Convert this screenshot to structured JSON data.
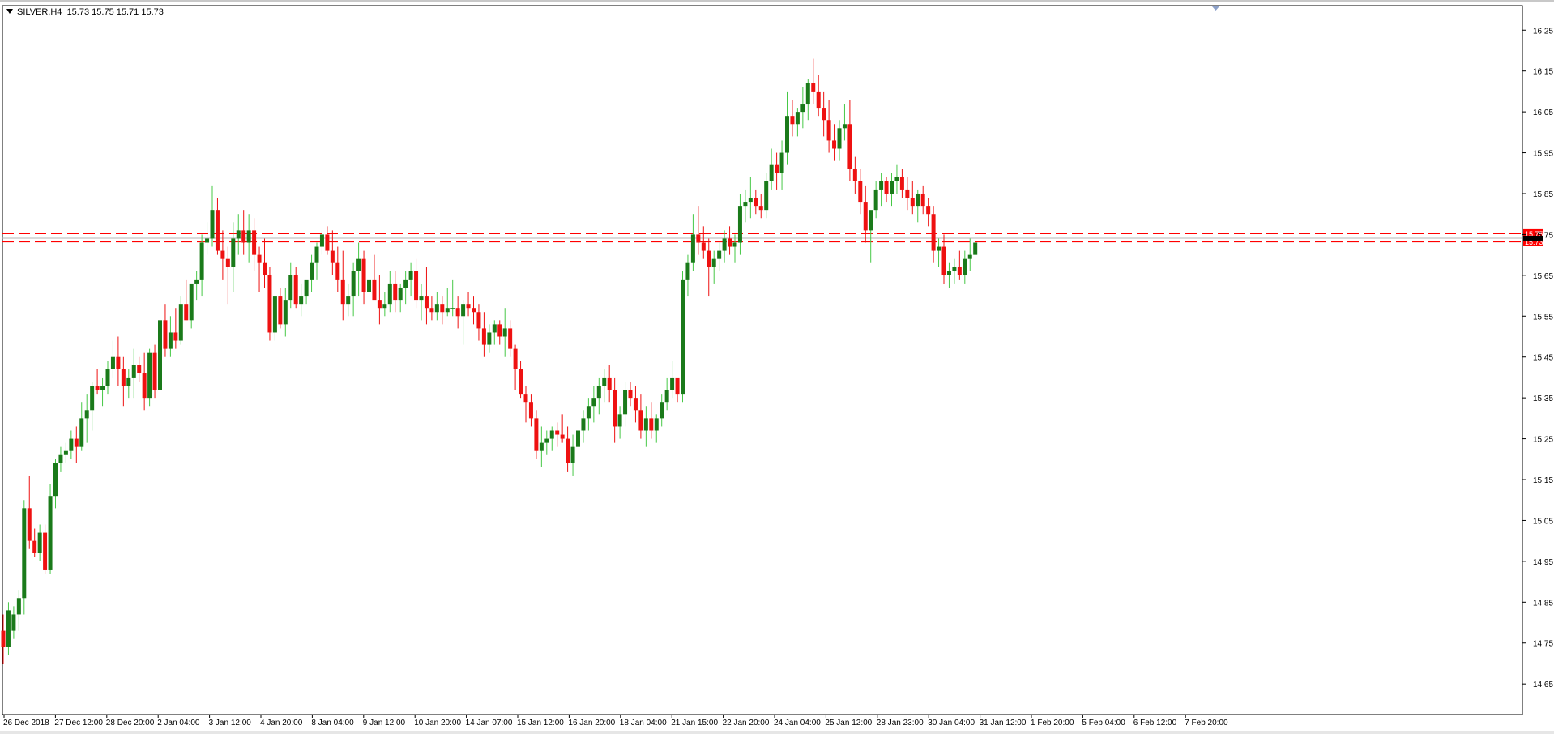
{
  "symbol": {
    "name": "SILVER,H4",
    "open": "15.73",
    "high": "15.75",
    "low": "15.71",
    "close": "15.73"
  },
  "chart_data": {
    "type": "candlestick",
    "ylim": [
      14.575,
      16.31
    ],
    "y_ticks": [
      "16.25",
      "16.15",
      "16.05",
      "15.95",
      "15.85",
      "15.75",
      "15.65",
      "15.55",
      "15.45",
      "15.35",
      "15.25",
      "15.15",
      "15.05",
      "14.95",
      "14.85",
      "14.75",
      "14.65"
    ],
    "x_ticks": [
      "26 Dec 2018",
      "27 Dec 12:00",
      "28 Dec 20:00",
      "2 Jan 04:00",
      "3 Jan 12:00",
      "4 Jan 20:00",
      "8 Jan 04:00",
      "9 Jan 12:00",
      "10 Jan 20:00",
      "14 Jan 07:00",
      "15 Jan 12:00",
      "16 Jan 20:00",
      "18 Jan 04:00",
      "21 Jan 15:00",
      "22 Jan 20:00",
      "24 Jan 04:00",
      "25 Jan 12:00",
      "28 Jan 23:00",
      "30 Jan 04:00",
      "31 Jan 12:00",
      "1 Feb 20:00",
      "5 Feb 04:00",
      "6 Feb 12:00",
      "7 Feb 20:00"
    ],
    "price_lines": [
      {
        "label": "15.75",
        "value": 15.752,
        "color": "#ff0000"
      },
      {
        "label": "15.73",
        "value": 15.732,
        "color": "#ff0000"
      }
    ],
    "current_price_line": 15.741,
    "candles": [
      [
        14.78,
        14.82,
        14.7,
        14.74
      ],
      [
        14.74,
        14.85,
        14.72,
        14.83
      ],
      [
        14.78,
        14.84,
        14.76,
        14.82
      ],
      [
        14.82,
        14.88,
        14.78,
        14.86
      ],
      [
        14.86,
        15.1,
        14.82,
        15.08
      ],
      [
        15.08,
        15.16,
        14.98,
        15.0
      ],
      [
        15.0,
        15.03,
        14.96,
        14.97
      ],
      [
        14.97,
        15.04,
        14.95,
        15.02
      ],
      [
        15.02,
        15.04,
        14.92,
        14.93
      ],
      [
        14.93,
        15.14,
        14.92,
        15.11
      ],
      [
        15.11,
        15.2,
        15.08,
        15.19
      ],
      [
        15.19,
        15.23,
        15.17,
        15.21
      ],
      [
        15.21,
        15.24,
        15.19,
        15.22
      ],
      [
        15.22,
        15.27,
        15.2,
        15.25
      ],
      [
        15.25,
        15.28,
        15.19,
        15.23
      ],
      [
        15.23,
        15.34,
        15.22,
        15.3
      ],
      [
        15.3,
        15.36,
        15.24,
        15.32
      ],
      [
        15.32,
        15.39,
        15.27,
        15.38
      ],
      [
        15.38,
        15.42,
        15.36,
        15.37
      ],
      [
        15.37,
        15.4,
        15.33,
        15.38
      ],
      [
        15.38,
        15.44,
        15.36,
        15.42
      ],
      [
        15.42,
        15.49,
        15.4,
        15.45
      ],
      [
        15.45,
        15.5,
        15.38,
        15.42
      ],
      [
        15.42,
        15.45,
        15.33,
        15.38
      ],
      [
        15.38,
        15.42,
        15.35,
        15.4
      ],
      [
        15.4,
        15.47,
        15.35,
        15.43
      ],
      [
        15.43,
        15.45,
        15.39,
        15.41
      ],
      [
        15.41,
        15.46,
        15.32,
        15.35
      ],
      [
        15.35,
        15.47,
        15.33,
        15.46
      ],
      [
        15.46,
        15.48,
        15.35,
        15.37
      ],
      [
        15.37,
        15.56,
        15.36,
        15.54
      ],
      [
        15.54,
        15.58,
        15.45,
        15.47
      ],
      [
        15.47,
        15.55,
        15.45,
        15.51
      ],
      [
        15.51,
        15.57,
        15.47,
        15.49
      ],
      [
        15.49,
        15.6,
        15.48,
        15.58
      ],
      [
        15.58,
        15.64,
        15.54,
        15.54
      ],
      [
        15.54,
        15.61,
        15.52,
        15.63
      ],
      [
        15.63,
        15.66,
        15.59,
        15.64
      ],
      [
        15.64,
        15.75,
        15.6,
        15.73
      ],
      [
        15.73,
        15.78,
        15.7,
        15.74
      ],
      [
        15.74,
        15.87,
        15.72,
        15.81
      ],
      [
        15.81,
        15.84,
        15.7,
        15.71
      ],
      [
        15.71,
        15.76,
        15.64,
        15.69
      ],
      [
        15.69,
        15.72,
        15.58,
        15.67
      ],
      [
        15.67,
        15.78,
        15.61,
        15.74
      ],
      [
        15.74,
        15.8,
        15.7,
        15.76
      ],
      [
        15.76,
        15.81,
        15.7,
        15.73
      ],
      [
        15.73,
        15.8,
        15.68,
        15.76
      ],
      [
        15.76,
        15.79,
        15.66,
        15.7
      ],
      [
        15.7,
        15.72,
        15.61,
        15.68
      ],
      [
        15.68,
        15.74,
        15.62,
        15.65
      ],
      [
        15.65,
        15.67,
        15.49,
        15.51
      ],
      [
        15.51,
        15.58,
        15.49,
        15.6
      ],
      [
        15.6,
        15.62,
        15.52,
        15.53
      ],
      [
        15.53,
        15.62,
        15.5,
        15.59
      ],
      [
        15.59,
        15.68,
        15.57,
        15.65
      ],
      [
        15.65,
        15.67,
        15.57,
        15.58
      ],
      [
        15.58,
        15.63,
        15.55,
        15.6
      ],
      [
        15.6,
        15.62,
        15.58,
        15.64
      ],
      [
        15.64,
        15.7,
        15.61,
        15.68
      ],
      [
        15.68,
        15.73,
        15.64,
        15.72
      ],
      [
        15.72,
        15.76,
        15.7,
        15.75
      ],
      [
        15.75,
        15.77,
        15.7,
        15.71
      ],
      [
        15.71,
        15.76,
        15.65,
        15.68
      ],
      [
        15.68,
        15.72,
        15.61,
        15.64
      ],
      [
        15.64,
        15.71,
        15.54,
        15.58
      ],
      [
        15.58,
        15.63,
        15.55,
        15.6
      ],
      [
        15.6,
        15.68,
        15.55,
        15.66
      ],
      [
        15.66,
        15.73,
        15.6,
        15.69
      ],
      [
        15.69,
        15.71,
        15.58,
        15.61
      ],
      [
        15.61,
        15.67,
        15.55,
        15.64
      ],
      [
        15.64,
        15.7,
        15.6,
        15.59
      ],
      [
        15.59,
        15.65,
        15.53,
        15.57
      ],
      [
        15.57,
        15.61,
        15.55,
        15.58
      ],
      [
        15.58,
        15.66,
        15.56,
        15.63
      ],
      [
        15.63,
        15.66,
        15.56,
        15.59
      ],
      [
        15.59,
        15.63,
        15.56,
        15.62
      ],
      [
        15.62,
        15.66,
        15.58,
        15.64
      ],
      [
        15.64,
        15.68,
        15.6,
        15.66
      ],
      [
        15.66,
        15.69,
        15.57,
        15.59
      ],
      [
        15.59,
        15.63,
        15.54,
        15.6
      ],
      [
        15.6,
        15.67,
        15.53,
        15.57
      ],
      [
        15.57,
        15.6,
        15.54,
        15.56
      ],
      [
        15.56,
        15.61,
        15.54,
        15.58
      ],
      [
        15.58,
        15.6,
        15.53,
        15.56
      ],
      [
        15.56,
        15.62,
        15.55,
        15.57
      ],
      [
        15.57,
        15.64,
        15.55,
        15.57
      ],
      [
        15.57,
        15.6,
        15.52,
        15.55
      ],
      [
        15.55,
        15.59,
        15.48,
        15.58
      ],
      [
        15.58,
        15.61,
        15.55,
        15.57
      ],
      [
        15.57,
        15.6,
        15.53,
        15.56
      ],
      [
        15.56,
        15.58,
        15.49,
        15.52
      ],
      [
        15.52,
        15.56,
        15.45,
        15.48
      ],
      [
        15.48,
        15.53,
        15.46,
        15.51
      ],
      [
        15.51,
        15.54,
        15.48,
        15.53
      ],
      [
        15.53,
        15.54,
        15.48,
        15.5
      ],
      [
        15.5,
        15.57,
        15.45,
        15.52
      ],
      [
        15.52,
        15.54,
        15.45,
        15.47
      ],
      [
        15.47,
        15.48,
        15.37,
        15.42
      ],
      [
        15.42,
        15.44,
        15.35,
        15.36
      ],
      [
        15.36,
        15.38,
        15.29,
        15.34
      ],
      [
        15.34,
        15.36,
        15.28,
        15.3
      ],
      [
        15.3,
        15.32,
        15.2,
        15.22
      ],
      [
        15.22,
        15.28,
        15.18,
        15.24
      ],
      [
        15.24,
        15.27,
        15.21,
        15.25
      ],
      [
        15.25,
        15.28,
        15.22,
        15.27
      ],
      [
        15.27,
        15.29,
        15.23,
        15.26
      ],
      [
        15.26,
        15.31,
        15.24,
        15.25
      ],
      [
        15.25,
        15.28,
        15.17,
        15.19
      ],
      [
        15.19,
        15.26,
        15.16,
        15.23
      ],
      [
        15.23,
        15.28,
        15.2,
        15.27
      ],
      [
        15.27,
        15.32,
        15.24,
        15.3
      ],
      [
        15.3,
        15.35,
        15.27,
        15.33
      ],
      [
        15.33,
        15.38,
        15.29,
        15.35
      ],
      [
        15.35,
        15.4,
        15.31,
        15.38
      ],
      [
        15.38,
        15.42,
        15.34,
        15.4
      ],
      [
        15.4,
        15.43,
        15.34,
        15.37
      ],
      [
        15.37,
        15.4,
        15.24,
        15.28
      ],
      [
        15.28,
        15.33,
        15.25,
        15.31
      ],
      [
        15.31,
        15.39,
        15.28,
        15.37
      ],
      [
        15.37,
        15.39,
        15.33,
        15.35
      ],
      [
        15.35,
        15.38,
        15.29,
        15.32
      ],
      [
        15.32,
        15.36,
        15.25,
        15.27
      ],
      [
        15.27,
        15.33,
        15.23,
        15.3
      ],
      [
        15.3,
        15.34,
        15.25,
        15.27
      ],
      [
        15.27,
        15.31,
        15.24,
        15.3
      ],
      [
        15.3,
        15.36,
        15.28,
        15.34
      ],
      [
        15.34,
        15.4,
        15.32,
        15.37
      ],
      [
        15.37,
        15.44,
        15.35,
        15.4
      ],
      [
        15.4,
        15.39,
        15.34,
        15.36
      ],
      [
        15.36,
        15.66,
        15.34,
        15.64
      ],
      [
        15.64,
        15.7,
        15.6,
        15.68
      ],
      [
        15.68,
        15.8,
        15.66,
        15.75
      ],
      [
        15.75,
        15.82,
        15.7,
        15.73
      ],
      [
        15.73,
        15.77,
        15.69,
        15.71
      ],
      [
        15.71,
        15.74,
        15.6,
        15.67
      ],
      [
        15.67,
        15.71,
        15.63,
        15.69
      ],
      [
        15.69,
        15.73,
        15.66,
        15.71
      ],
      [
        15.71,
        15.76,
        15.68,
        15.74
      ],
      [
        15.74,
        15.77,
        15.7,
        15.72
      ],
      [
        15.72,
        15.75,
        15.68,
        15.73
      ],
      [
        15.73,
        15.85,
        15.7,
        15.82
      ],
      [
        15.82,
        15.86,
        15.78,
        15.83
      ],
      [
        15.83,
        15.89,
        15.79,
        15.84
      ],
      [
        15.84,
        15.86,
        15.8,
        15.82
      ],
      [
        15.82,
        15.85,
        15.79,
        15.81
      ],
      [
        15.81,
        15.9,
        15.79,
        15.88
      ],
      [
        15.88,
        15.96,
        15.86,
        15.92
      ],
      [
        15.92,
        15.95,
        15.86,
        15.9
      ],
      [
        15.9,
        15.98,
        15.86,
        15.95
      ],
      [
        15.95,
        16.1,
        15.92,
        16.04
      ],
      [
        16.04,
        16.08,
        15.99,
        16.02
      ],
      [
        16.02,
        16.06,
        15.99,
        16.05
      ],
      [
        16.05,
        16.11,
        16.01,
        16.07
      ],
      [
        16.07,
        16.13,
        16.03,
        16.12
      ],
      [
        16.12,
        16.18,
        16.07,
        16.1
      ],
      [
        16.1,
        16.14,
        16.04,
        16.06
      ],
      [
        16.06,
        16.1,
        15.99,
        16.03
      ],
      [
        16.03,
        16.08,
        15.95,
        15.98
      ],
      [
        15.98,
        16.02,
        15.93,
        15.96
      ],
      [
        15.96,
        16.03,
        15.93,
        16.01
      ],
      [
        16.01,
        16.07,
        15.98,
        16.02
      ],
      [
        16.02,
        16.08,
        15.88,
        15.91
      ],
      [
        15.91,
        15.94,
        15.85,
        15.88
      ],
      [
        15.88,
        15.91,
        15.8,
        15.83
      ],
      [
        15.83,
        15.87,
        15.73,
        15.76
      ],
      [
        15.76,
        15.78,
        15.68,
        15.81
      ],
      [
        15.81,
        15.88,
        15.79,
        15.86
      ],
      [
        15.86,
        15.9,
        15.82,
        15.88
      ],
      [
        15.88,
        15.89,
        15.83,
        15.85
      ],
      [
        15.85,
        15.9,
        15.82,
        15.88
      ],
      [
        15.88,
        15.92,
        15.85,
        15.89
      ],
      [
        15.89,
        15.91,
        15.84,
        15.86
      ],
      [
        15.86,
        15.89,
        15.81,
        15.84
      ],
      [
        15.84,
        15.88,
        15.8,
        15.82
      ],
      [
        15.82,
        15.86,
        15.78,
        15.85
      ],
      [
        15.85,
        15.87,
        15.8,
        15.82
      ],
      [
        15.82,
        15.84,
        15.77,
        15.8
      ],
      [
        15.8,
        15.82,
        15.68,
        15.71
      ],
      [
        15.71,
        15.74,
        15.67,
        15.72
      ],
      [
        15.72,
        15.75,
        15.63,
        15.65
      ],
      [
        15.65,
        15.68,
        15.62,
        15.66
      ],
      [
        15.66,
        15.69,
        15.63,
        15.67
      ],
      [
        15.67,
        15.71,
        15.64,
        15.65
      ],
      [
        15.65,
        15.71,
        15.63,
        15.69
      ],
      [
        15.69,
        15.74,
        15.66,
        15.7
      ],
      [
        15.7,
        15.73,
        15.71,
        15.73
      ]
    ]
  }
}
